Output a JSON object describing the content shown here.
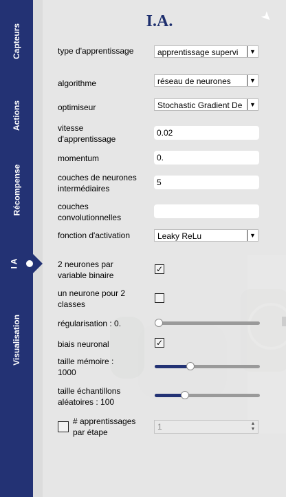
{
  "sidebar": {
    "tabs": [
      {
        "label": "Capteurs"
      },
      {
        "label": "Actions"
      },
      {
        "label": "Récompense"
      },
      {
        "label": "I A"
      },
      {
        "label": "Visualisation"
      }
    ]
  },
  "panel": {
    "title": "I.A.",
    "fields": {
      "learning_type": {
        "label": "type d'apprentissage",
        "value": "apprentissage supervi"
      },
      "algorithm": {
        "label": "algorithme",
        "value": "réseau de neurones"
      },
      "optimizer": {
        "label": "optimiseur",
        "value": "Stochastic Gradient De"
      },
      "learning_rate": {
        "label": "vitesse d'apprentissage",
        "value": "0.02"
      },
      "momentum": {
        "label": "momentum",
        "value": "0."
      },
      "hidden_layers": {
        "label": "couches de neurones intermédiaires",
        "value": "5"
      },
      "conv_layers": {
        "label": "couches convolutionnelles",
        "value": ""
      },
      "activation": {
        "label": "fonction d'activation",
        "value": "Leaky ReLu"
      },
      "two_neurons_binary": {
        "label": "2 neurones par variable binaire",
        "checked": true
      },
      "one_neuron_two_classes": {
        "label": "un neurone pour 2 classes",
        "checked": false
      },
      "regularization": {
        "label": "régularisation : 0.",
        "level": 0.0
      },
      "neural_bias": {
        "label": "biais neuronal",
        "checked": true
      },
      "memory_size": {
        "label": "taille mémoire : 1000",
        "level": 0.34
      },
      "sample_size": {
        "label": "taille échantillons aléatoires : 100",
        "level": 0.29
      },
      "learnings_per_step": {
        "label": "# apprentissages par étape",
        "checked": false,
        "value": "1"
      }
    }
  },
  "colors": {
    "sidebar": "#233274",
    "title": "#1e2f6e",
    "slider_fill": "#233274"
  }
}
